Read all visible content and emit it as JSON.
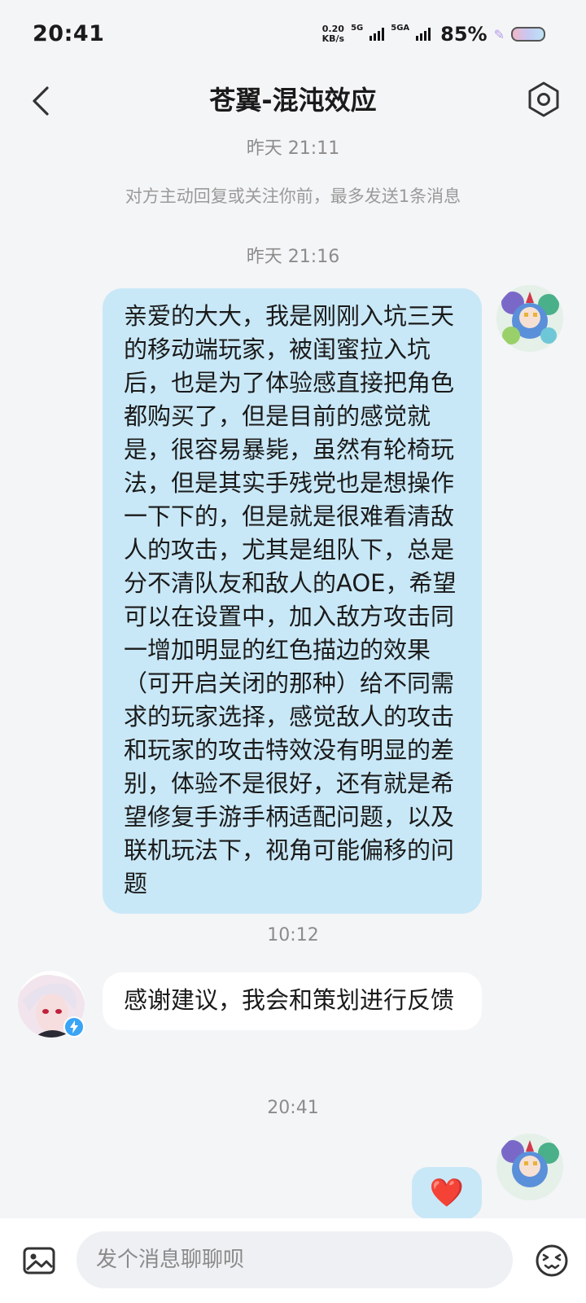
{
  "status": {
    "time": "20:41",
    "speed_value": "0.20",
    "speed_unit": "KB/s",
    "net1": "5G",
    "net2": "5GA",
    "battery": "85%"
  },
  "header": {
    "title": "苍翼-混沌效应"
  },
  "messages": {
    "ts1": "昨天 21:11",
    "notice": "对方主动回复或关注你前，最多发送1条消息",
    "ts2": "昨天 21:16",
    "outgoing1": "亲爱的大大，我是刚刚入坑三天的移动端玩家，被闺蜜拉入坑后，也是为了体验感直接把角色都购买了，但是目前的感觉就是，很容易暴毙，虽然有轮椅玩法，但是其实手残党也是想操作一下下的，但是就是很难看清敌人的攻击，尤其是组队下，总是分不清队友和敌人的AOE，希望可以在设置中，加入敌方攻击同一增加明显的红色描边的效果（可开启关闭的那种）给不同需求的玩家选择，感觉敌人的攻击和玩家的攻击特效没有明显的差别，体验不是很好，还有就是希望修复手游手柄适配问题，以及联机玩法下，视角可能偏移的问题",
    "ts3": "10:12",
    "incoming1": "感谢建议，我会和策划进行反馈",
    "ts4": "20:41",
    "outgoing2": "❤️"
  },
  "composer": {
    "placeholder": "发个消息聊聊呗"
  },
  "colors": {
    "bubble_out": "#c9e8f7",
    "bubble_in": "#ffffff",
    "background": "#f4f5f7",
    "verified_badge": "#3aa4f5",
    "heart": "#e53935"
  },
  "icons": {
    "back": "chevron-left-icon",
    "settings": "hexagon-gear-icon",
    "image": "image-icon",
    "emoji": "emoji-face-icon",
    "verified": "lightning-badge-icon"
  }
}
